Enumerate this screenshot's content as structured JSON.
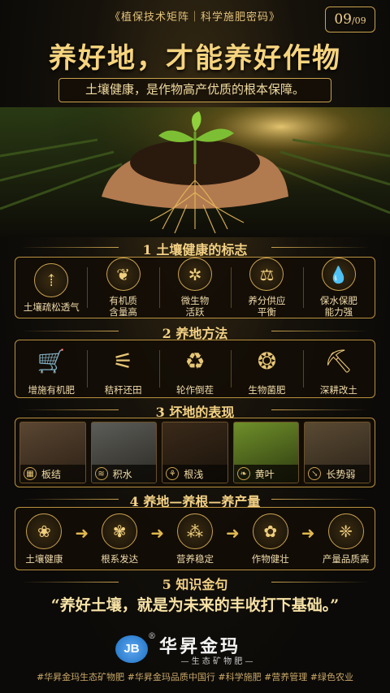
{
  "header": {
    "series": "《植保技术矩阵｜科学施肥密码》",
    "page_current": "09",
    "page_total": "/09",
    "title": "养好地，才能养好作物",
    "subtitle": "土壤健康，是作物高产优质的根本保障。"
  },
  "sections": [
    {
      "title": "1 土壤健康的标志",
      "items": [
        {
          "icon": "soil-layers-icon",
          "glyph": "⇡",
          "label": "土壤疏松透气"
        },
        {
          "icon": "leaf-icon",
          "glyph": "❦",
          "label": "有机质\n含量高"
        },
        {
          "icon": "microbe-icon",
          "glyph": "✲",
          "label": "微生物\n活跃"
        },
        {
          "icon": "scale-icon",
          "glyph": "⚖",
          "label": "养分供应\n平衡"
        },
        {
          "icon": "water-drop-icon",
          "glyph": "💧",
          "label": "保水保肥\n能力强"
        }
      ]
    },
    {
      "title": "2 养地方法",
      "items": [
        {
          "icon": "wheelbarrow-icon",
          "glyph": "🛒",
          "label": "增施有机肥"
        },
        {
          "icon": "straw-icon",
          "glyph": "⚟",
          "label": "秸秆还田"
        },
        {
          "icon": "rotation-icon",
          "glyph": "♻",
          "label": "轮作倒茬"
        },
        {
          "icon": "bacteria-icon",
          "glyph": "❂",
          "label": "生物菌肥"
        },
        {
          "icon": "plow-icon",
          "glyph": "⛏",
          "label": "深耕改土"
        }
      ]
    },
    {
      "title": "3 坏地的表现",
      "items": [
        {
          "icon": "brick-icon",
          "glyph": "▦",
          "label": "板结"
        },
        {
          "icon": "water-icon",
          "glyph": "≋",
          "label": "积水"
        },
        {
          "icon": "root-icon",
          "glyph": "⚘",
          "label": "根浅"
        },
        {
          "icon": "yellow-leaf-icon",
          "glyph": "❧",
          "label": "黄叶"
        },
        {
          "icon": "decline-chart-icon",
          "glyph": "↘",
          "label": "长势弱"
        }
      ]
    },
    {
      "title": "4 养地—养根—养产量",
      "items": [
        {
          "icon": "sprout-icon",
          "glyph": "❀",
          "label": "土壤健康"
        },
        {
          "icon": "roots-icon",
          "glyph": "✾",
          "label": "根系发达"
        },
        {
          "icon": "nutrient-icon",
          "glyph": "⁂",
          "label": "营养稳定"
        },
        {
          "icon": "plant-icon",
          "glyph": "✿",
          "label": "作物健壮"
        },
        {
          "icon": "wheat-icon",
          "glyph": "❈",
          "label": "产量品质高"
        }
      ]
    },
    {
      "title": "5 知识金句",
      "quote_open": "“",
      "quote": "养好土壤，就是为未来的丰收打下基础。",
      "quote_close": "”"
    }
  ],
  "brand": {
    "name": "华昇金玛",
    "tagline": "— 生 态 矿 物 肥 —",
    "registered": "®",
    "monogram": "JB"
  },
  "hashtags": "#华昇金玛生态矿物肥   #华昇金玛品质中国行   #科学施肥   #营养管理   #绿色农业",
  "colors": {
    "gold": "#e8c77a",
    "background": "#0b0a08",
    "brand_blue": "#1b6fc2"
  }
}
